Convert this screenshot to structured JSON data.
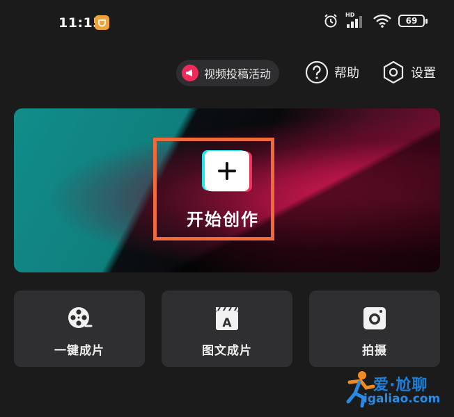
{
  "status_bar": {
    "time": "11:15",
    "network_label": "HD",
    "battery": "69"
  },
  "header": {
    "promo_label": "视频投稿活动",
    "help_label": "帮助",
    "settings_label": "设置"
  },
  "hero": {
    "create_label": "开始创作"
  },
  "cards": [
    {
      "label": "一键成片",
      "icon": "film-reel-icon"
    },
    {
      "label": "图文成片",
      "icon": "text-clapper-icon"
    },
    {
      "label": "拍摄",
      "icon": "camera-icon"
    }
  ],
  "watermark": {
    "text": "爱·尬聊",
    "url": "igaliao.com"
  },
  "colors": {
    "highlight": "#ef6b3c",
    "accent_red": "#ee2b5a",
    "teal": "#118d8a"
  }
}
